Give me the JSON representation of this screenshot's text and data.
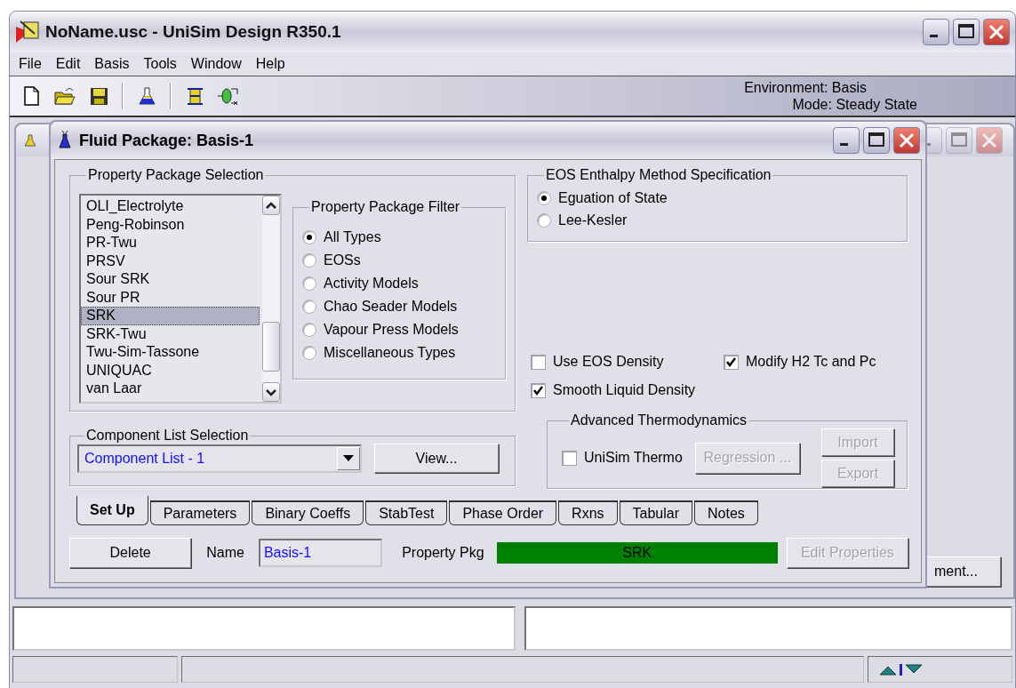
{
  "app_window": {
    "title": "NoName.usc - UniSim Design R350.1"
  },
  "menu": [
    {
      "label": "File"
    },
    {
      "label": "Edit"
    },
    {
      "label": "Basis"
    },
    {
      "label": "Tools"
    },
    {
      "label": "Window"
    },
    {
      "label": "Help"
    }
  ],
  "toolbar": {
    "environment": "Environment: Basis",
    "mode": "Mode: Steady State"
  },
  "background_window": {
    "button": "ment..."
  },
  "dialog": {
    "title": "Fluid Package: Basis-1",
    "property_package_selection": {
      "title": "Property Package Selection",
      "items": [
        {
          "label": "OLI_Electrolyte",
          "selected": false
        },
        {
          "label": "Peng-Robinson",
          "selected": false
        },
        {
          "label": "PR-Twu",
          "selected": false
        },
        {
          "label": "PRSV",
          "selected": false
        },
        {
          "label": "Sour SRK",
          "selected": false
        },
        {
          "label": "Sour PR",
          "selected": false
        },
        {
          "label": "SRK",
          "selected": true
        },
        {
          "label": "SRK-Twu",
          "selected": false
        },
        {
          "label": "Twu-Sim-Tassone",
          "selected": false
        },
        {
          "label": "UNIQUAC",
          "selected": false
        },
        {
          "label": "van Laar",
          "selected": false
        }
      ]
    },
    "property_package_filter": {
      "title": "Property Package Filter",
      "options": [
        {
          "label": "All Types",
          "selected": true
        },
        {
          "label": "EOSs",
          "selected": false
        },
        {
          "label": "Activity Models",
          "selected": false
        },
        {
          "label": "Chao Seader Models",
          "selected": false
        },
        {
          "label": "Vapour Press Models",
          "selected": false
        },
        {
          "label": "Miscellaneous Types",
          "selected": false
        }
      ]
    },
    "component_list_selection": {
      "title": "Component List Selection",
      "value": "Component List - 1",
      "button": "View..."
    },
    "eos_enthalpy": {
      "title": "EOS Enthalpy Method Specification",
      "options": [
        {
          "label": "Eguation of State",
          "selected": true
        },
        {
          "label": "Lee-Kesler",
          "selected": false
        }
      ]
    },
    "checkboxes": [
      {
        "label": "Use EOS Density",
        "checked": false
      },
      {
        "label": "Modify H2 Tc and Pc",
        "checked": true
      },
      {
        "label": "Smooth Liquid Density",
        "checked": true
      }
    ],
    "advanced_thermodynamics": {
      "title": "Advanced Thermodynamics",
      "unisim_thermo": {
        "label": "UniSim Thermo",
        "checked": false
      },
      "regression": {
        "label": "Regression ...",
        "disabled": true
      },
      "import": {
        "label": "Import",
        "disabled": true
      },
      "export": {
        "label": "Export",
        "disabled": true
      }
    },
    "tabs": [
      {
        "label": "Set Up",
        "selected": true
      },
      {
        "label": "Parameters",
        "selected": false
      },
      {
        "label": "Binary Coeffs",
        "selected": false
      },
      {
        "label": "StabTest",
        "selected": false
      },
      {
        "label": "Phase Order",
        "selected": false
      },
      {
        "label": "Rxns",
        "selected": false
      },
      {
        "label": "Tabular",
        "selected": false
      },
      {
        "label": "Notes",
        "selected": false
      }
    ],
    "footer": {
      "delete": "Delete",
      "name_label": "Name",
      "name_value": "Basis-1",
      "property_pkg_label": "Property Pkg",
      "property_pkg_value": "SRK",
      "edit_properties": {
        "label": "Edit Properties",
        "disabled": true
      }
    }
  }
}
